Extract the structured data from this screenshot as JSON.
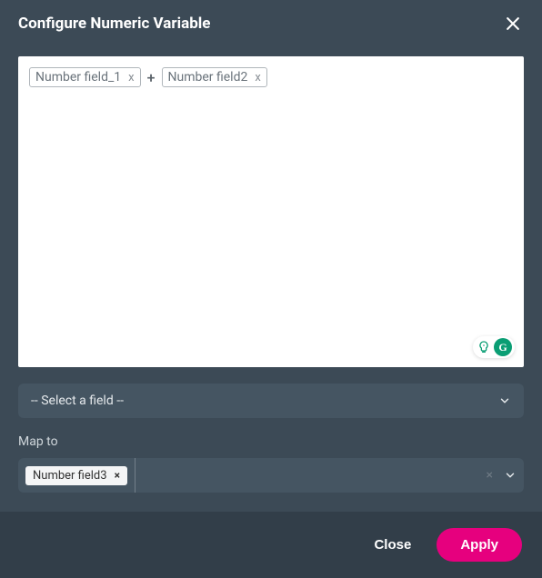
{
  "header": {
    "title": "Configure Numeric Variable"
  },
  "expression": {
    "tokens": [
      {
        "label": "Number field_1",
        "remove": "x"
      },
      {
        "label": "Number field2",
        "remove": "x"
      }
    ],
    "operator": "+"
  },
  "fieldSelect": {
    "placeholder": "-- Select a field --"
  },
  "mapTo": {
    "label": "Map to",
    "chip": {
      "label": "Number field3",
      "remove": "×"
    },
    "clear": "×"
  },
  "footer": {
    "close": "Close",
    "apply": "Apply"
  },
  "grammarly": {
    "letter": "G"
  }
}
